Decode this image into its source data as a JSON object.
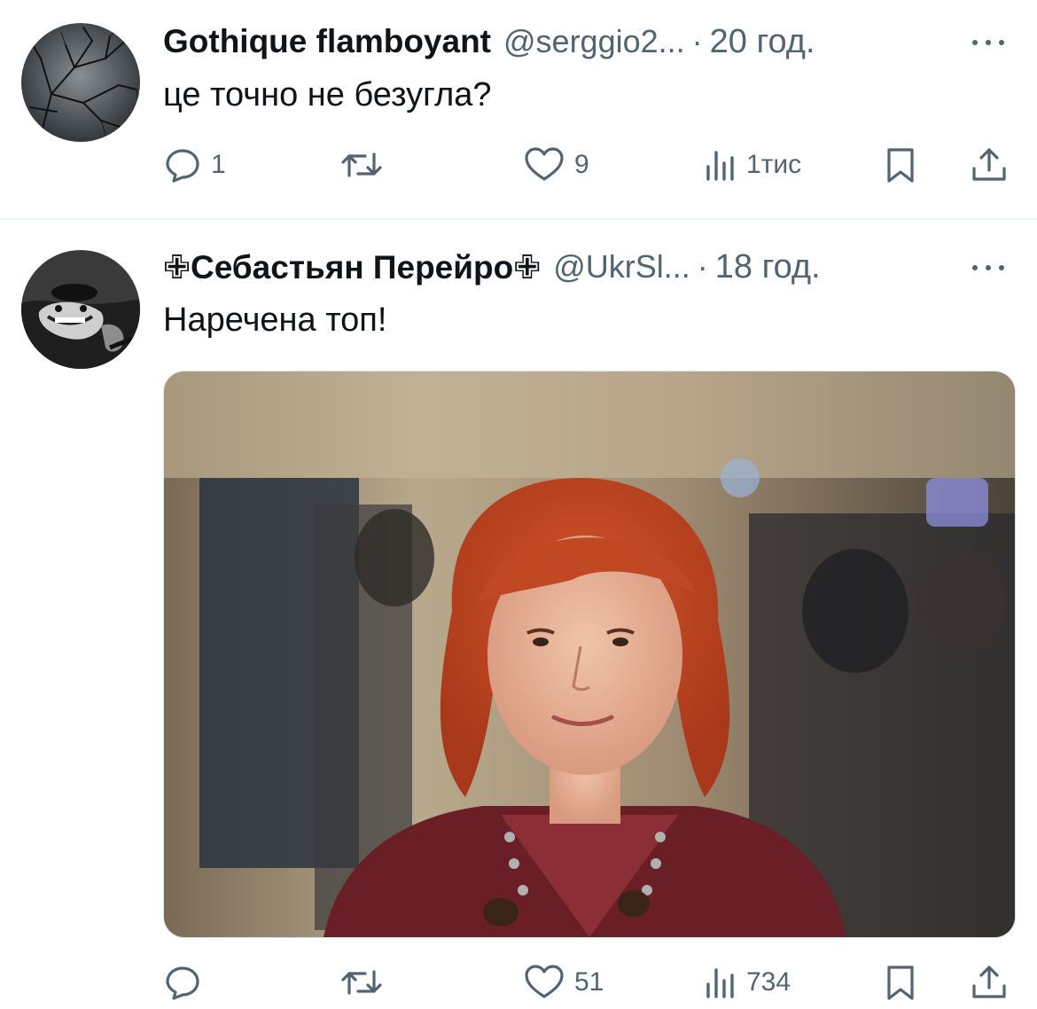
{
  "tweets": [
    {
      "name": "Gothique flamboyant",
      "handle": "@serggio2...",
      "separator": "·",
      "time": "20 год.",
      "text": "це точно не безугла?",
      "avatar_icon": "avatar-bare-tree-icon",
      "replies": "1",
      "retweets": "",
      "likes": "9",
      "views": "1тис"
    },
    {
      "name": "✙Себастьян Перейро✙",
      "handle": "@UkrSl...",
      "separator": "·",
      "time": "18 год.",
      "text": "Наречена топ!",
      "avatar_icon": "avatar-caricature-icon",
      "media_icon": "photo-red-haired-woman",
      "replies": "",
      "retweets": "",
      "likes": "51",
      "views": "734"
    }
  ],
  "colors": {
    "text_primary": "#0f1419",
    "text_secondary": "#536471",
    "divider": "#eff3f4"
  }
}
